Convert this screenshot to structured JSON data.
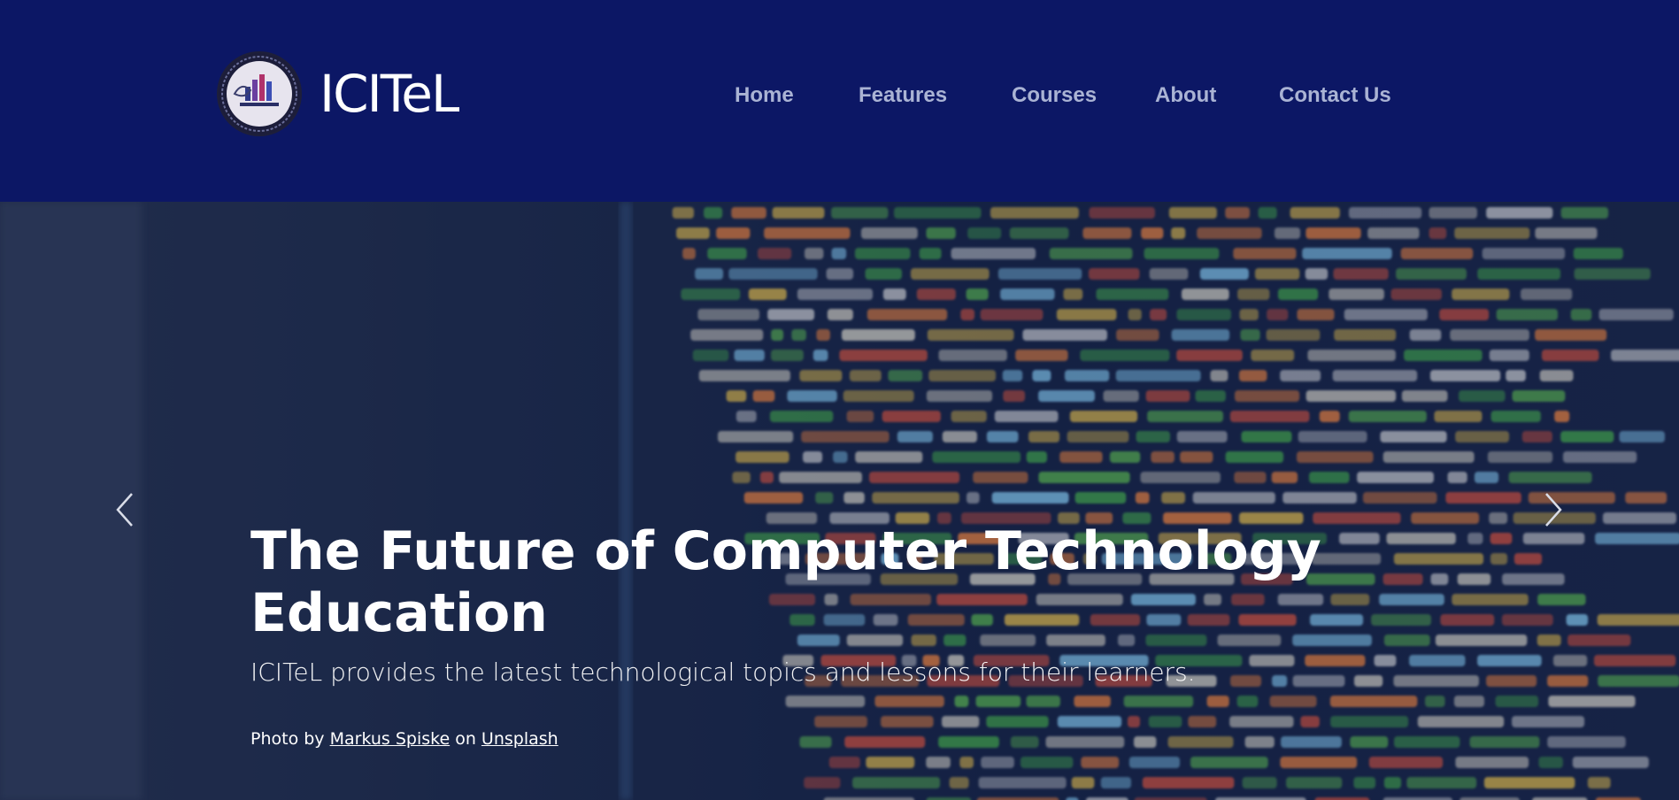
{
  "brand": {
    "name": "ICITeL",
    "logo_icon": "institute-logo-icon"
  },
  "nav": {
    "items": [
      {
        "label": "Home"
      },
      {
        "label": "Features"
      },
      {
        "label": "Courses"
      },
      {
        "label": "About"
      },
      {
        "label": "Contact Us"
      }
    ]
  },
  "hero": {
    "title_line1": "The Future of Computer Technology",
    "title_line2": "Education",
    "subtitle": "ICITeL provides the latest technological topics and lessons for their learners.",
    "credit": {
      "prefix": "Photo by",
      "author": "Markus Spiske",
      "middle": "on",
      "source": "Unsplash"
    },
    "prev_icon": "chevron-left-icon",
    "next_icon": "chevron-right-icon"
  },
  "colors": {
    "navbar_bg": "#0c1765",
    "nav_text": "#aab3d4",
    "hero_text": "#ffffff"
  }
}
